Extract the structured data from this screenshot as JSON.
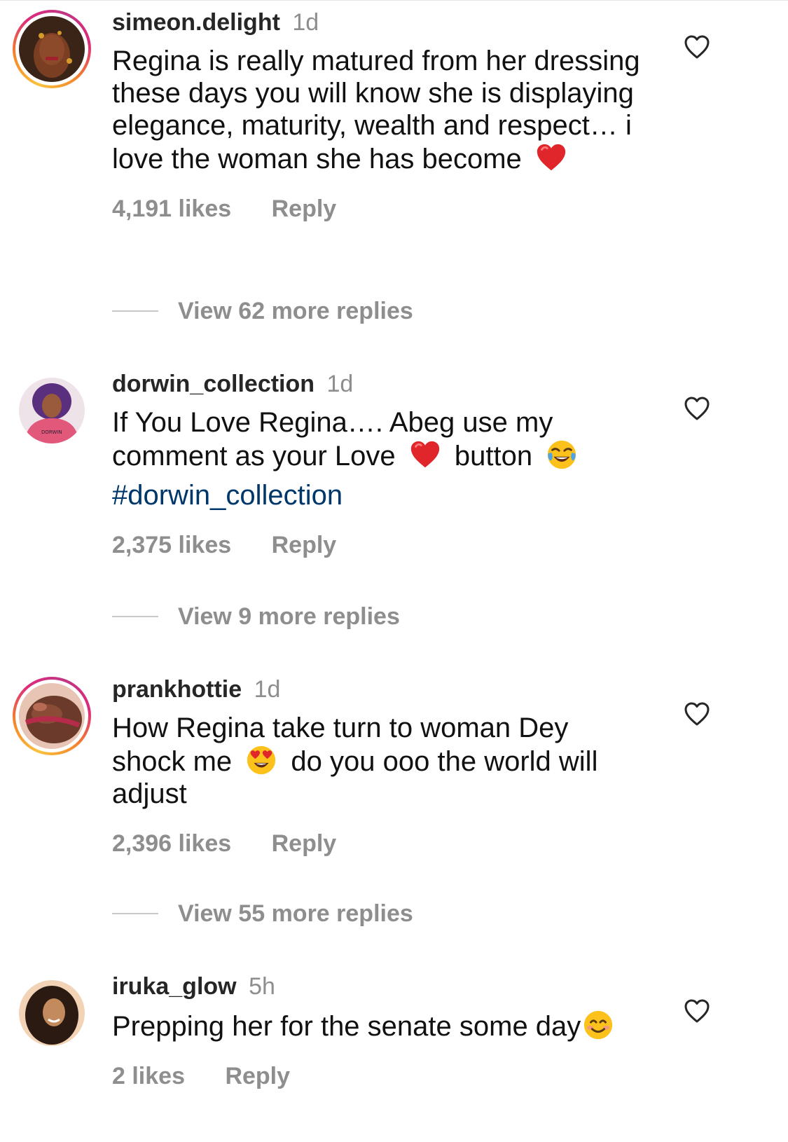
{
  "comments": [
    {
      "username": "simeon.delight",
      "time": "1d",
      "text_before": "Regina is really matured from her dressing these days you will know she is displaying elegance, maturity, wealth and respect… i love the woman she has become",
      "emoji_end": "red-heart",
      "likes": "4,191 likes",
      "reply": "Reply",
      "view_replies": "View 62 more replies",
      "avatar_colors": [
        "#3a2418",
        "#7a3e22",
        "#d69a2b"
      ]
    },
    {
      "username": "dorwin_collection",
      "time": "1d",
      "text_part1": "If You Love Regina…. Abeg use my comment as your Love",
      "text_part2": "button",
      "hashtag": "#dorwin_collection",
      "likes": "2,375 likes",
      "reply": "Reply",
      "view_replies": "View 9 more replies",
      "avatar_colors": [
        "#5a2f7e",
        "#e2587a",
        "#f3b6c6"
      ]
    },
    {
      "username": "prankhottie",
      "time": "1d",
      "text_part1": "How Regina take turn to woman Dey shock me",
      "text_part2": "do you ooo the world will adjust",
      "likes": "2,396 likes",
      "reply": "Reply",
      "view_replies": "View 55 more replies",
      "avatar_colors": [
        "#6b3a2a",
        "#b76b55",
        "#e8c4b4"
      ]
    },
    {
      "username": "iruka_glow",
      "time": "5h",
      "text_before": "Prepping her for the senate some day",
      "emoji_end": "smiling-face",
      "likes": "2 likes",
      "reply": "Reply",
      "avatar_colors": [
        "#2a1a12",
        "#c38a5e",
        "#f2d3b6"
      ]
    }
  ],
  "colors": {
    "username": "#262626",
    "muted": "#8e8e8e",
    "hashtag": "#00376b",
    "heart_emoji": "#e0252b",
    "story_ring": [
      "#f9c23c",
      "#f58529",
      "#dd2a7b",
      "#c13584"
    ]
  },
  "icons": {
    "like": "heart-outline-icon",
    "emoji_love": "red-heart-emoji",
    "emoji_laugh": "tears-of-joy-emoji",
    "emoji_heart_eyes": "heart-eyes-emoji",
    "emoji_smile": "smiling-face-emoji"
  }
}
